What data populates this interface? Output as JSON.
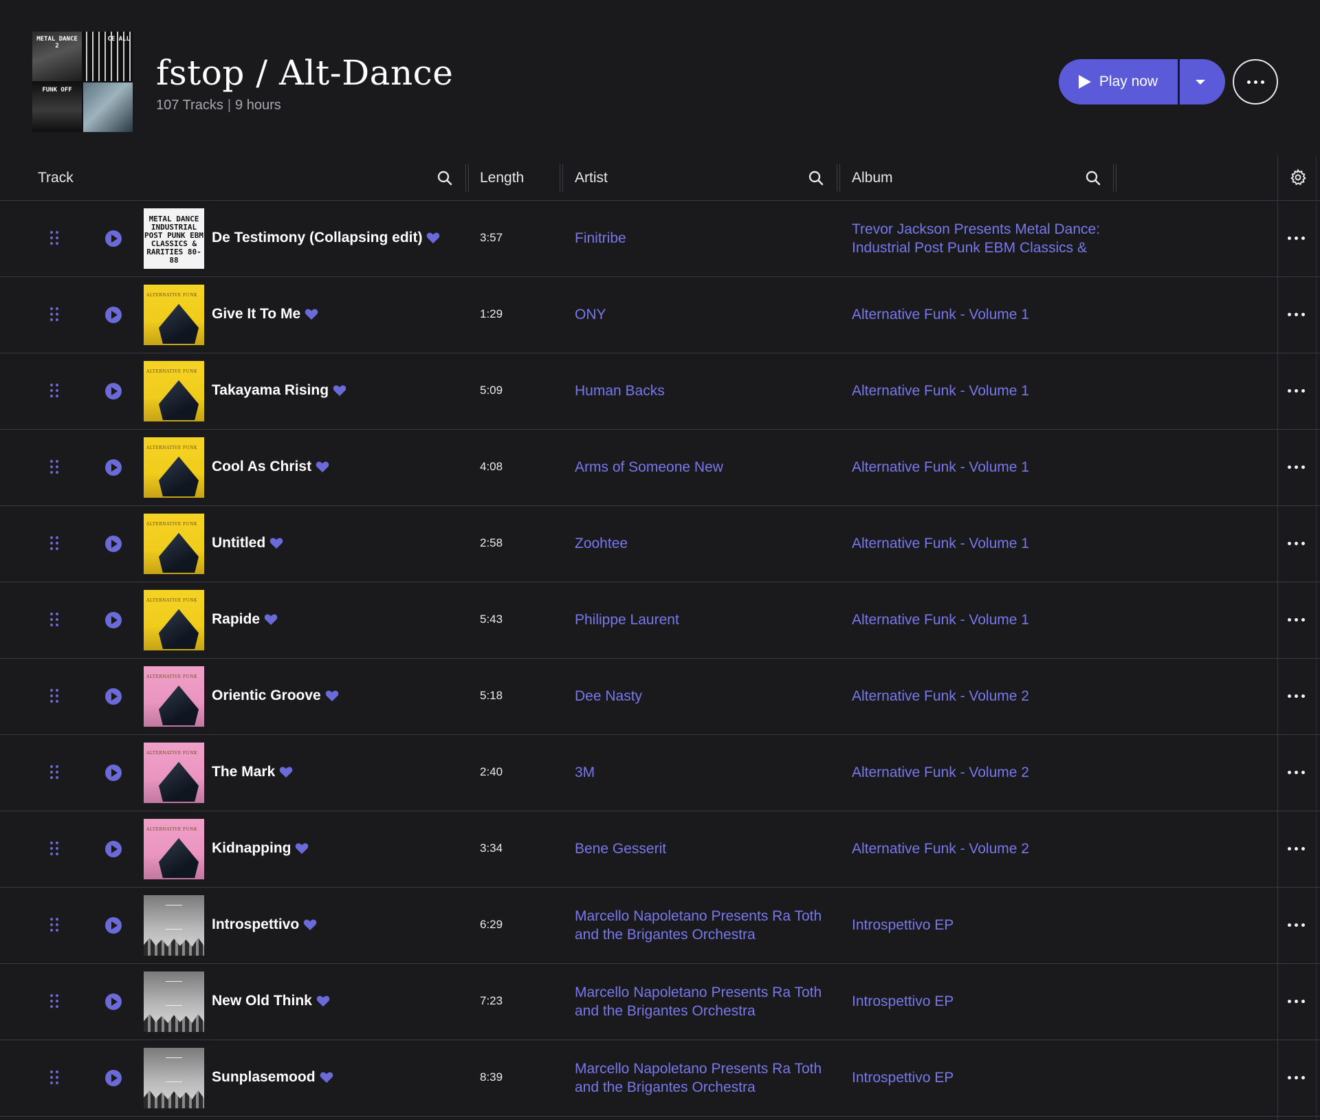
{
  "playlist": {
    "title": "fstop / Alt-Dance",
    "tracks_count": "107 Tracks",
    "separator": "|",
    "duration": "9 hours",
    "cover_tiles": [
      {
        "text": "METAL DANCE 2"
      },
      {
        "text": "CE ALL"
      },
      {
        "text": "FUNK OFF"
      },
      {
        "text": ""
      }
    ]
  },
  "actions": {
    "play_label": "Play now",
    "accent_color": "#5b5bd9"
  },
  "columns": {
    "track": "Track",
    "length": "Length",
    "artist": "Artist",
    "album": "Album"
  },
  "tracks": [
    {
      "title": "De Testimony (Collapsing edit)",
      "length": "3:57",
      "artist": "Finitribe",
      "album": "Trevor Jackson Presents Metal Dance: Industrial Post Punk EBM Classics &",
      "art": "metal",
      "art_text": "METAL DANCE INDUSTRIAL POST PUNK EBM CLASSICS & RARITIES 80-88"
    },
    {
      "title": "Give It To Me",
      "length": "1:29",
      "artist": "ONY",
      "album": "Alternative Funk - Volume 1",
      "art": "yellow",
      "art_text": "ALTERNATIVE FUNK"
    },
    {
      "title": "Takayama Rising",
      "length": "5:09",
      "artist": "Human Backs",
      "album": "Alternative Funk - Volume 1",
      "art": "yellow",
      "art_text": "ALTERNATIVE FUNK"
    },
    {
      "title": "Cool As Christ",
      "length": "4:08",
      "artist": "Arms of Someone New",
      "album": "Alternative Funk - Volume 1",
      "art": "yellow",
      "art_text": "ALTERNATIVE FUNK"
    },
    {
      "title": "Untitled",
      "length": "2:58",
      "artist": "Zoohtee",
      "album": "Alternative Funk - Volume 1",
      "art": "yellow",
      "art_text": "ALTERNATIVE FUNK"
    },
    {
      "title": "Rapide",
      "length": "5:43",
      "artist": "Philippe Laurent",
      "album": "Alternative Funk - Volume 1",
      "art": "yellow",
      "art_text": "ALTERNATIVE FUNK"
    },
    {
      "title": "Orientic Groove",
      "length": "5:18",
      "artist": "Dee Nasty",
      "album": "Alternative Funk - Volume 2",
      "art": "pink",
      "art_text": "ALTERNATIVE FUNK"
    },
    {
      "title": "The Mark",
      "length": "2:40",
      "artist": "3M",
      "album": "Alternative Funk - Volume 2",
      "art": "pink",
      "art_text": "ALTERNATIVE FUNK"
    },
    {
      "title": "Kidnapping",
      "length": "3:34",
      "artist": "Bene Gesserit",
      "album": "Alternative Funk - Volume 2",
      "art": "pink",
      "art_text": "ALTERNATIVE FUNK"
    },
    {
      "title": "Introspettivo",
      "length": "6:29",
      "artist": "Marcello Napoletano Presents Ra Toth and the Brigantes Orchestra",
      "album": "Introspettivo EP",
      "art": "grey",
      "art_text": ""
    },
    {
      "title": "New Old Think",
      "length": "7:23",
      "artist": "Marcello Napoletano Presents Ra Toth and the Brigantes Orchestra",
      "album": "Introspettivo EP",
      "art": "grey",
      "art_text": ""
    },
    {
      "title": "Sunplasemood",
      "length": "8:39",
      "artist": "Marcello Napoletano Presents Ra Toth and the Brigantes Orchestra",
      "album": "Introspettivo EP",
      "art": "grey",
      "art_text": ""
    }
  ],
  "icons": {
    "play": "play-icon",
    "dropdown": "chevron-down-icon",
    "more": "more-horizontal-icon",
    "search": "search-icon",
    "settings": "gear-icon",
    "drag": "drag-handle-icon",
    "favorite": "heart-icon"
  },
  "colors": {
    "background": "#1a1a1d",
    "link": "#7878ec",
    "heart": "#6a6ad9"
  }
}
